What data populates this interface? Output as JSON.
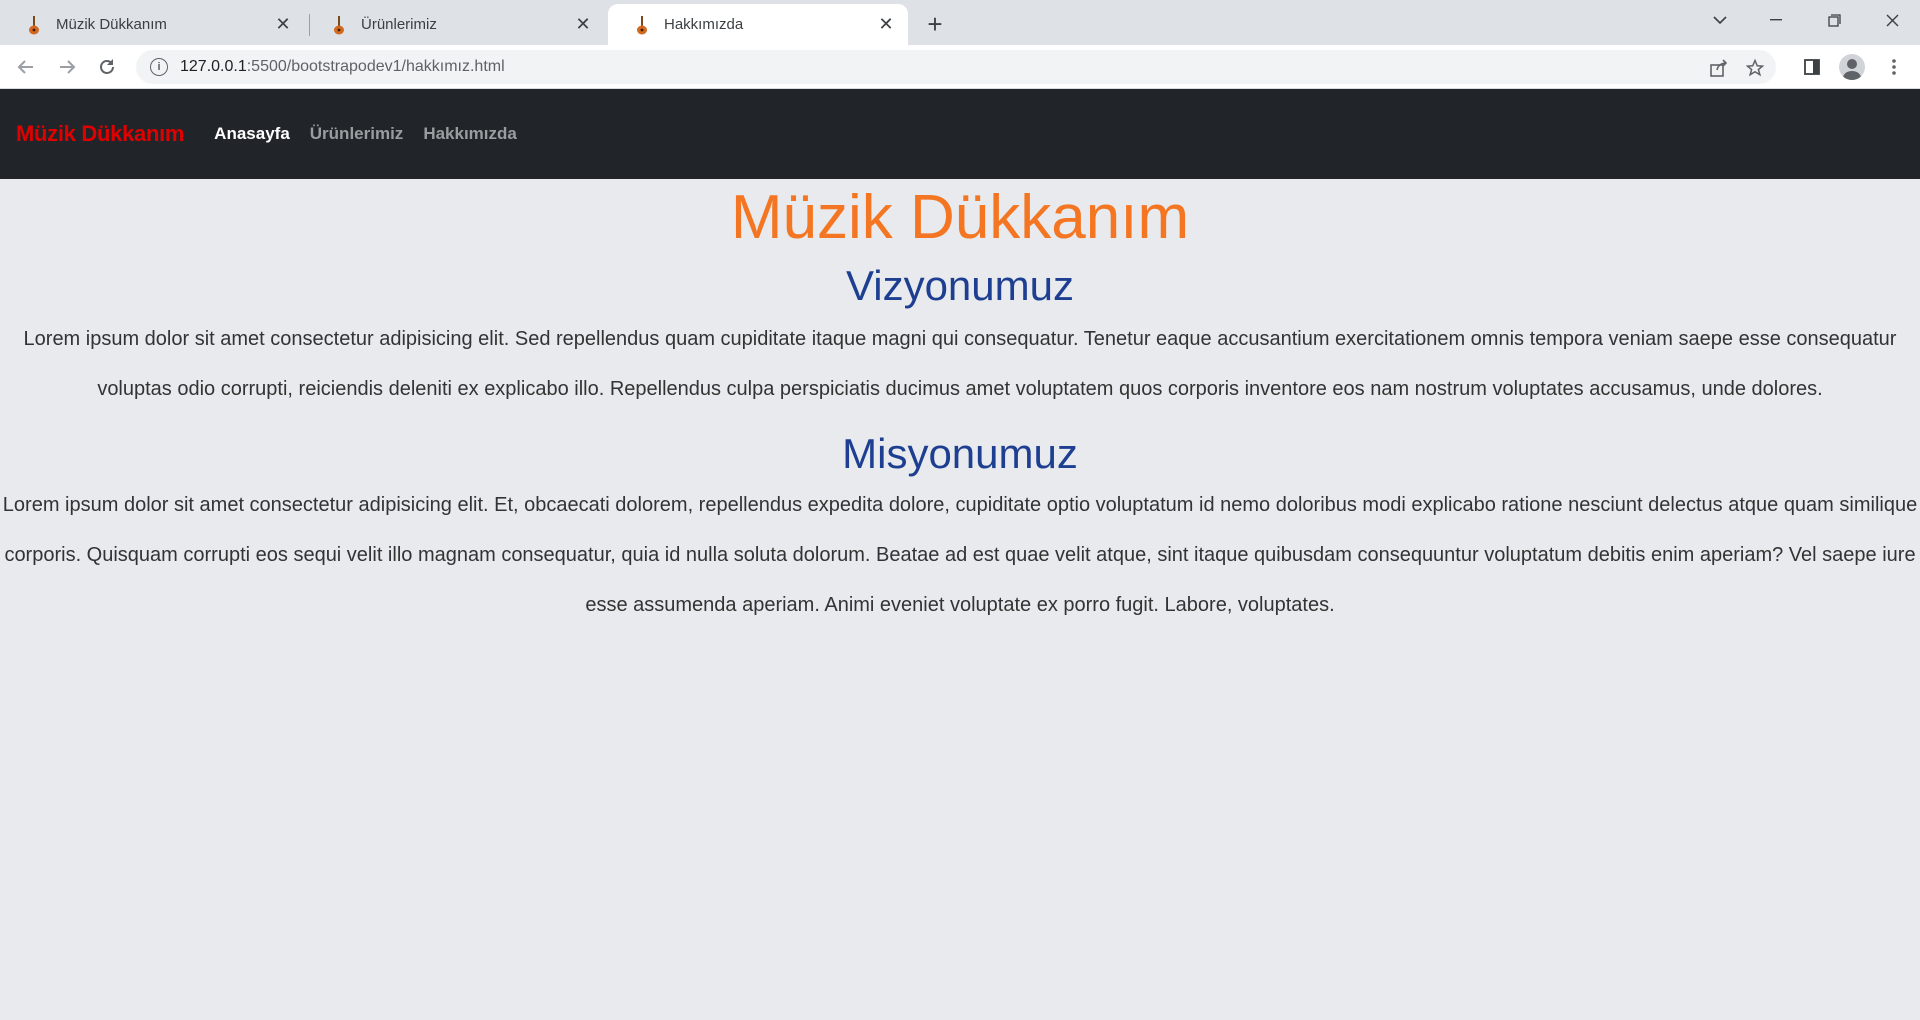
{
  "browser": {
    "tabs": [
      {
        "title": "Müzik Dükkanım",
        "active": false
      },
      {
        "title": "Ürünlerimiz",
        "active": false
      },
      {
        "title": "Hakkımızda",
        "active": true
      }
    ],
    "url_host": "127.0.0.1",
    "url_path": ":5500/bootstrapodev1/hakkımız.html",
    "icons": {
      "back": "arrow-left-icon",
      "forward": "arrow-right-icon",
      "reload": "reload-icon",
      "site_info": "info-icon",
      "share": "share-icon",
      "bookmark": "star-icon",
      "side_panel": "side-panel-icon",
      "profile": "profile-icon",
      "menu": "kebab-menu-icon"
    }
  },
  "navbar": {
    "brand": "Müzik Dükkanım",
    "links": [
      "Anasayfa",
      "Ürünlerimiz",
      "Hakkımızda"
    ],
    "brand_color": "#e00000",
    "background": "#212529"
  },
  "main": {
    "title": "Müzik Dükkanım",
    "title_color": "#f47622",
    "vision_heading": "Vizyonumuz",
    "vision_text": "Lorem ipsum dolor sit amet consectetur adipisicing elit. Sed repellendus quam cupiditate itaque magni qui consequatur. Tenetur eaque accusantium exercitationem omnis tempora veniam saepe esse consequatur voluptas odio corrupti, reiciendis deleniti ex explicabo illo. Repellendus culpa perspiciatis ducimus amet voluptatem quos corporis inventore eos nam nostrum voluptates accusamus, unde dolores.",
    "mission_heading": "Misyonumuz",
    "mission_text": "Lorem ipsum dolor sit amet consectetur adipisicing elit. Et, obcaecati dolorem, repellendus expedita dolore, cupiditate optio voluptatum id nemo doloribus modi explicabo ratione nesciunt delectus atque quam similique corporis. Quisquam corrupti eos sequi velit illo magnam consequatur, quia id nulla soluta dolorum. Beatae ad est quae velit atque, sint itaque quibusdam consequuntur voluptatum debitis enim aperiam? Vel saepe iure esse assumenda aperiam. Animi eveniet voluptate ex porro fugit. Labore, voluptates.",
    "heading_color": "#1e3f91"
  }
}
